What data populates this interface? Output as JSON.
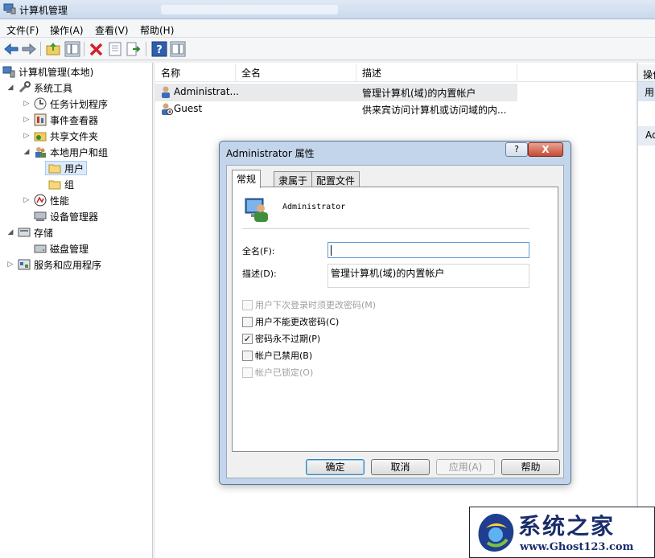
{
  "window": {
    "title": "计算机管理"
  },
  "menu": [
    "文件(F)",
    "操作(A)",
    "查看(V)",
    "帮助(H)"
  ],
  "toolbar": {
    "icons": [
      "back-arrow-icon",
      "forward-arrow-icon",
      "up-folder-icon",
      "show-hide-tree-icon",
      "delete-icon",
      "properties-icon",
      "export-list-icon",
      "help-icon",
      "show-hide-action-pane-icon"
    ]
  },
  "tree": {
    "root": "计算机管理(本地)",
    "system_tools": "系统工具",
    "task_scheduler": "任务计划程序",
    "event_viewer": "事件查看器",
    "shared_folders": "共享文件夹",
    "local_users_groups": "本地用户和组",
    "users": "用户",
    "groups": "组",
    "performance": "性能",
    "device_manager": "设备管理器",
    "storage": "存储",
    "disk_management": "磁盘管理",
    "services_apps": "服务和应用程序"
  },
  "list": {
    "columns": [
      "名称",
      "全名",
      "描述"
    ],
    "rows": [
      {
        "name": "Administrat...",
        "fullname": "",
        "desc": "管理计算机(域)的内置帐户"
      },
      {
        "name": "Guest",
        "fullname": "",
        "desc": "供来宾访问计算机或访问域的内..."
      }
    ]
  },
  "actions": {
    "header": "操作",
    "item1": "用",
    "item2": "Ad"
  },
  "dialog": {
    "title": "Administrator 属性",
    "help_btn": "?",
    "close_btn": "X",
    "tabs": [
      "常规",
      "隶属于",
      "配置文件"
    ],
    "username": "Administrator",
    "fullname_label": "全名(F):",
    "fullname_value": "",
    "desc_label": "描述(D):",
    "desc_value": "管理计算机(域)的内置帐户",
    "checkboxes": [
      {
        "label": "用户下次登录时须更改密码(M)",
        "checked": false,
        "disabled": true
      },
      {
        "label": "用户不能更改密码(C)",
        "checked": false,
        "disabled": false
      },
      {
        "label": "密码永不过期(P)",
        "checked": true,
        "disabled": false
      },
      {
        "label": "帐户已禁用(B)",
        "checked": false,
        "disabled": false
      },
      {
        "label": "帐户已锁定(O)",
        "checked": false,
        "disabled": true
      }
    ],
    "buttons": {
      "ok": "确定",
      "cancel": "取消",
      "apply": "应用(A)",
      "help": "帮助"
    }
  },
  "watermark": {
    "title": "系统之家",
    "url": "www.Ghost123.com"
  },
  "check_mark": "✓"
}
